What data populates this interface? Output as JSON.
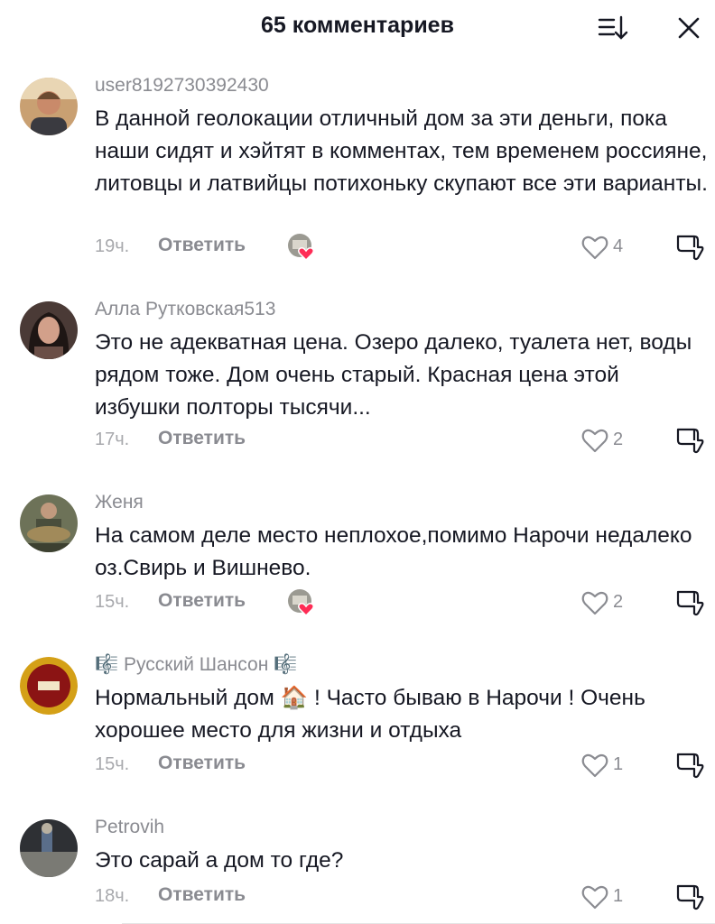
{
  "header": {
    "title": "65 комментариев"
  },
  "icons": {
    "sort": "sort-icon",
    "close": "close-icon",
    "like": "heart-icon",
    "dislike": "thumbs-down-icon"
  },
  "colors": {
    "like_heart": "#fe2c55"
  },
  "comments": [
    {
      "username": "user8192730392430",
      "text": "В данной геолокации отличный дом за эти деньги, пока наши сидят и хэйтят в комментах, тем временем россияне, литовцы и латвийцы потихоньку скупают все эти варианты.",
      "time": "19ч.",
      "reply": "Ответить",
      "likes": "4",
      "creator_liked": true
    },
    {
      "username": "Алла Рутковская513",
      "text": "Это не адекватная цена. Озеро далеко, туалета нет, воды рядом тоже. Дом очень старый. Красная цена этой избушки полторы тысячи...",
      "time": "17ч.",
      "reply": "Ответить",
      "likes": "2",
      "creator_liked": false
    },
    {
      "username": "Женя",
      "text": "На самом деле место неплохое,помимо Нарочи недалеко оз.Свирь и Вишнево.",
      "time": "15ч.",
      "reply": "Ответить",
      "likes": "2",
      "creator_liked": true
    },
    {
      "username": "Русский Шансон",
      "note_emoji": "🎼",
      "text": "Нормальный дом 🏠 ! Часто бываю в Нарочи ! Очень хорошее место для жизни и отдыха",
      "time": "15ч.",
      "reply": "Ответить",
      "likes": "1",
      "creator_liked": false
    },
    {
      "username": "Petrovih",
      "text": "Это сарай а дом то где?",
      "time": "18ч.",
      "reply": "Ответить",
      "likes": "1",
      "creator_liked": false
    }
  ]
}
